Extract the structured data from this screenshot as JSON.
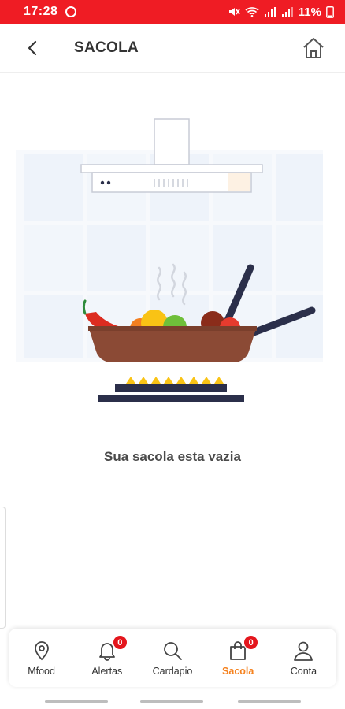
{
  "status_bar": {
    "time": "17:28",
    "battery": "11%"
  },
  "header": {
    "title": "SACOLA"
  },
  "empty_state": {
    "message": "Sua sacola esta vazia"
  },
  "bottom_nav": {
    "items": [
      {
        "label": "Mfood",
        "icon": "map-pin-icon"
      },
      {
        "label": "Alertas",
        "icon": "bell-icon",
        "badge": "0"
      },
      {
        "label": "Cardapio",
        "icon": "search-icon"
      },
      {
        "label": "Sacola",
        "icon": "shopping-bag-icon",
        "badge": "0",
        "active": true
      },
      {
        "label": "Conta",
        "icon": "user-icon"
      }
    ]
  },
  "colors": {
    "status_bar": "#ef1c24",
    "active_tab": "#f5821f",
    "badge": "#e4161d",
    "pan": "#8b4a35"
  }
}
